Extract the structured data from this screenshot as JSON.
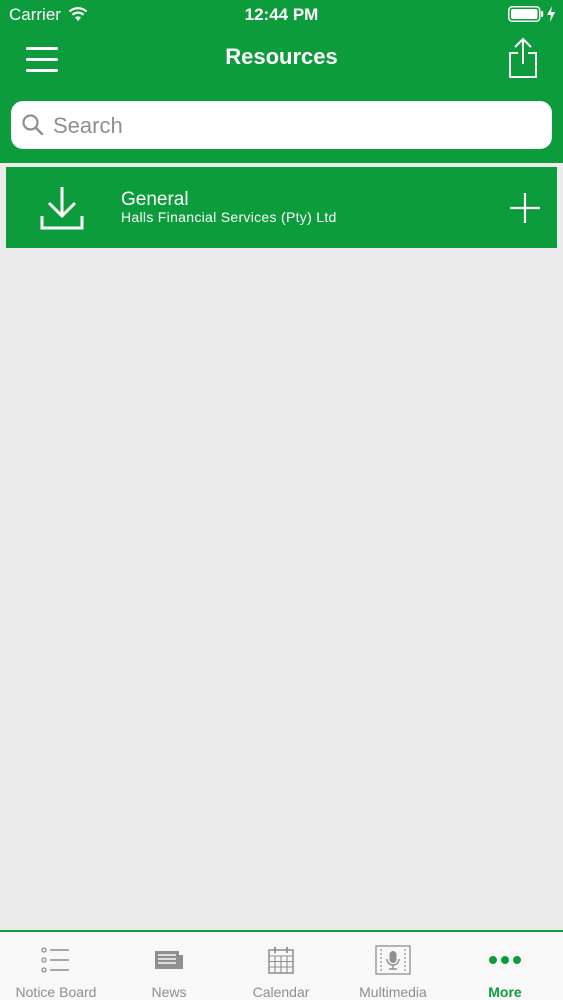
{
  "status_bar": {
    "carrier": "Carrier",
    "time": "12:44 PM"
  },
  "navbar": {
    "title": "Resources"
  },
  "search": {
    "placeholder": "Search",
    "value": ""
  },
  "resources": [
    {
      "title": "General",
      "subtitle": "Halls Financial Services (Pty) Ltd"
    }
  ],
  "tabs": [
    {
      "label": "Notice Board",
      "icon": "list-icon"
    },
    {
      "label": "News",
      "icon": "newspaper-icon"
    },
    {
      "label": "Calendar",
      "icon": "calendar-icon"
    },
    {
      "label": "Multimedia",
      "icon": "microphone-icon"
    },
    {
      "label": "More",
      "icon": "more-dots-icon"
    }
  ],
  "active_tab": "More",
  "colors": {
    "brand_green": "#0c9c3c",
    "background": "#ebebeb",
    "tab_inactive": "#8e8e93"
  }
}
